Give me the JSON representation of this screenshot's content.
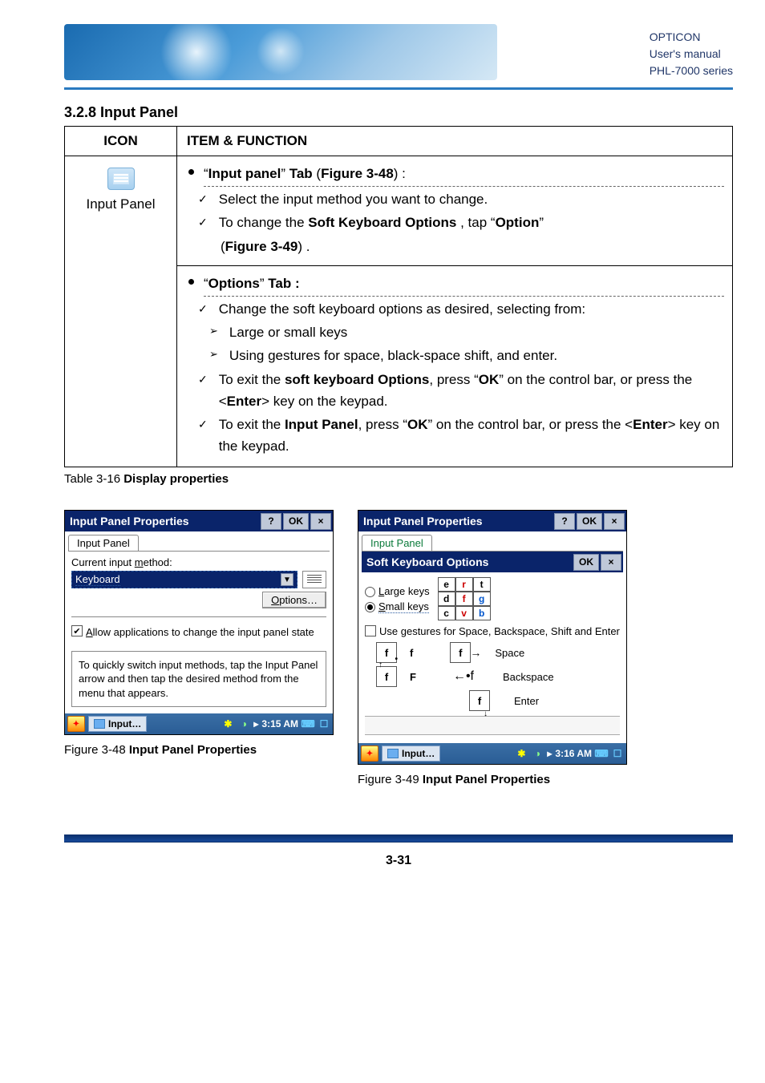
{
  "header": {
    "line1": "OPTICON",
    "line2": "User's manual",
    "line3": "PHL-7000 series"
  },
  "section_title": "3.2.8 Input Panel",
  "table": {
    "head_icon": "ICON",
    "head_item": "ITEM & FUNCTION",
    "icon_label": "Input Panel",
    "row1_header_pre": "“",
    "row1_header_bold": "Input panel",
    "row1_header_mid": "” ",
    "row1_header_tab": "Tab",
    "row1_header_paren_open": " (",
    "row1_header_fig": "Figure 3-48",
    "row1_header_paren_close": ") :",
    "row1_item1": "Select the input method you want to change.",
    "row1_item2_pre": "To change the ",
    "row1_item2_bold1": "Soft Keyboard Options",
    "row1_item2_mid": " , tap “",
    "row1_item2_bold2": "Option",
    "row1_item2_post": "”",
    "row1_item2_line2_open": "(",
    "row1_item2_line2_fig": "Figure 3-49",
    "row1_item2_line2_close": ") .",
    "row2_header_pre": "“",
    "row2_header_bold": "Options",
    "row2_header_mid": "” ",
    "row2_header_tab": "Tab :",
    "row2_item1": "Change the soft keyboard options as desired, selecting from:",
    "row2_sub1": "Large or small keys",
    "row2_sub2": "Using gestures for space, black-space shift, and enter.",
    "row2_item2_pre": "To exit the ",
    "row2_item2_bold": "soft keyboard Options",
    "row2_item2_mid": ", press “",
    "row2_item2_ok": "OK",
    "row2_item2_post": "” on the control bar, or press the <",
    "row2_item2_enter": "Enter",
    "row2_item2_end": "> key on the keypad.",
    "row2_item3_pre": "To exit the ",
    "row2_item3_bold": "Input Panel",
    "row2_item3_mid": ", press “",
    "row2_item3_ok": "OK",
    "row2_item3_post": "” on the control bar, or press the <",
    "row2_item3_enter": "Enter",
    "row2_item3_end": "> key on the keypad."
  },
  "table_caption_pre": "Table 3-16 ",
  "table_caption_bold": "Display properties",
  "fig48": {
    "title": "Input Panel Properties",
    "help": "?",
    "ok": "OK",
    "close": "×",
    "tab": "Input Panel",
    "label_method_pre": "Current input ",
    "label_method_u": "m",
    "label_method_post": "ethod:",
    "combo_value": "Keyboard",
    "options_btn_u": "O",
    "options_btn_rest": "ptions…",
    "allow_u": "A",
    "allow_rest": "llow applications to change the input panel state",
    "tip": "To quickly switch input methods, tap the Input Panel arrow and then tap the desired method from the menu that appears.",
    "task_label": "Input…",
    "time": "3:15 AM",
    "caption_pre": "Figure 3-48 ",
    "caption_bold": "Input Panel Properties"
  },
  "fig49": {
    "title": "Input Panel Properties",
    "help": "?",
    "ok": "OK",
    "close": "×",
    "tab": "Input Panel",
    "skb_title": "Soft Keyboard Options",
    "skb_ok": "OK",
    "skb_close": "×",
    "large_u": "L",
    "large_rest": "arge keys",
    "small_u": "S",
    "small_rest": "mall keys",
    "keys": [
      "e",
      "r",
      "t",
      "d",
      "f",
      "g",
      "c",
      "v",
      "b"
    ],
    "gest_pre": "Use ",
    "gest_u": "g",
    "gest_rest": "estures for Space, Backspace, Shift and Enter",
    "g_f": "f",
    "g_F": "F",
    "g_space": "Space",
    "g_back": "Backspace",
    "g_enter": "Enter",
    "task_label": "Input…",
    "time": "3:16 AM",
    "caption_pre": "Figure 3-49 ",
    "caption_bold": "Input Panel Properties"
  },
  "page_number": "3-31"
}
